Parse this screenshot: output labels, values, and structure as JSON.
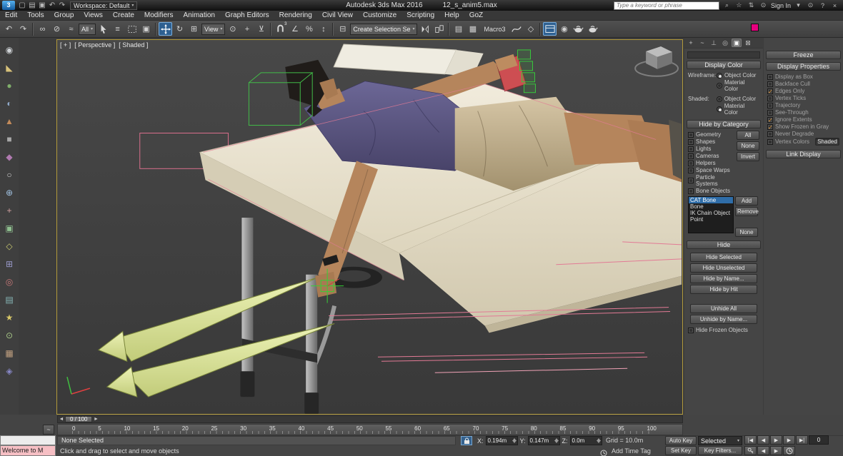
{
  "title_bar": {
    "logo_label": "3",
    "workspace_label": "Workspace: Default",
    "app_title": "Autodesk 3ds Max 2016",
    "file_name": "12_s_anim5.max",
    "search_placeholder": "Type a keyword or phrase",
    "sign_in_label": "Sign In"
  },
  "menu_bar": {
    "items": [
      "Edit",
      "Tools",
      "Group",
      "Views",
      "Create",
      "Modifiers",
      "Animation",
      "Graph Editors",
      "Rendering",
      "Civil View",
      "Customize",
      "Scripting",
      "Help",
      "GoZ"
    ]
  },
  "toolbar": {
    "selection_filter_value": "All",
    "reference_coordinate_value": "View",
    "named_selection_value": "Create Selection Se",
    "macro_label": "Macro3",
    "snap_label": "3"
  },
  "glyphs": {
    "undo": "↶",
    "redo": "↷",
    "link": "∞",
    "unlink": "⊘",
    "bind": "≈",
    "byname": "≡",
    "window": "▣",
    "rotate": "↻",
    "scale": "⊞",
    "center": "⊙",
    "manip": "+",
    "kbd": "⊻",
    "angle": "∠",
    "percent": "%",
    "spin": "↕",
    "namedsel": "⊟",
    "layers": "▤",
    "ribbon": "▦",
    "schematic": "◇",
    "material": "◉",
    "render": "●",
    "dd": "▾",
    "star": "☆",
    "help": "?",
    "close": "×",
    "person": "⊙",
    "left": "◄",
    "right": "►",
    "tostart": "|◀",
    "prevf": "◀",
    "play": "▶",
    "toend": "▶|",
    "curve": "~",
    "tab_create": "+",
    "tab_modify": "~",
    "tab_hier": "⊥",
    "tab_motion": "◎",
    "tab_display": "▣",
    "tab_util": "⊠"
  },
  "left_toolbar": {
    "glyphs": [
      "◉",
      "◣",
      "●",
      "◐",
      "▲",
      "■",
      "◆",
      "○",
      "⊕",
      "+",
      "▣",
      "◇",
      "⊞",
      "◎",
      "▤",
      "★",
      "⊙",
      "▦",
      "◈"
    ]
  },
  "viewport": {
    "plus_label": "[ + ]",
    "pov_label": "[ Perspective ]",
    "shading_label": "[ Shaded ]"
  },
  "command_panel": {
    "display_color": {
      "title": "Display Color",
      "wireframe_label": "Wireframe:",
      "shaded_label": "Shaded:",
      "object_color_label": "Object Color",
      "material_color_label": "Material Color"
    },
    "hide_by_category": {
      "title": "Hide by Category",
      "checkboxes": [
        "Geometry",
        "Shapes",
        "Lights",
        "Cameras",
        "Helpers",
        "Space Warps",
        "Particle Systems",
        "Bone Objects"
      ],
      "all_label": "All",
      "none_label": "None",
      "invert_label": "Invert",
      "list_items": [
        "CAT Bone",
        "Bone",
        "IK Chain Object",
        "Point"
      ],
      "add_label": "Add",
      "remove_label": "Remove",
      "list_none_label": "None"
    },
    "hide": {
      "title": "Hide",
      "buttons": [
        "Hide Selected",
        "Hide Unselected",
        "Hide by Name...",
        "Hide by Hit"
      ],
      "buttons2": [
        "Unhide All",
        "Unhide by Name..."
      ],
      "hide_frozen_label": "Hide Frozen Objects"
    }
  },
  "right_panel": {
    "freeze_title": "Freeze",
    "display_properties": {
      "title": "Display Properties",
      "items": [
        {
          "label": "Display as Box",
          "check": ""
        },
        {
          "label": "Backface Cull",
          "check": ""
        },
        {
          "label": "Edges Only",
          "check": "✓"
        },
        {
          "label": "Vertex Ticks",
          "check": ""
        },
        {
          "label": "Trajectory",
          "check": ""
        },
        {
          "label": "See-Through",
          "check": ""
        },
        {
          "label": "Ignore Extents",
          "check": "✓"
        },
        {
          "label": "Show Frozen in Gray",
          "check": "✓"
        },
        {
          "label": "Never Degrade",
          "check": ""
        },
        {
          "label": "Vertex Colors",
          "check": ""
        }
      ],
      "shaded_button_label": "Shaded"
    },
    "link_display_title": "Link Display"
  },
  "time_slider": {
    "value": "0 / 100"
  },
  "timeline": {
    "ticks": [
      "0",
      "5",
      "10",
      "15",
      "20",
      "25",
      "30",
      "35",
      "40",
      "45",
      "50",
      "55",
      "60",
      "65",
      "70",
      "75",
      "80",
      "85",
      "90",
      "95",
      "100"
    ]
  },
  "status_bar": {
    "listener_text": "Welcome to M",
    "selection_status": "None Selected",
    "prompt": "Click and drag to select and move objects",
    "x_label": "X:",
    "x_value": "0.194m",
    "y_label": "Y:",
    "y_value": "0.147m",
    "z_label": "Z:",
    "z_value": "0.0m",
    "grid_label": "Grid = 10.0m",
    "add_time_tag_label": "Add Time Tag",
    "auto_key_label": "Auto Key",
    "set_key_label": "Set Key",
    "selected_dropdown_value": "Selected",
    "key_filters_label": "Key Filters...",
    "current_frame": "0"
  }
}
